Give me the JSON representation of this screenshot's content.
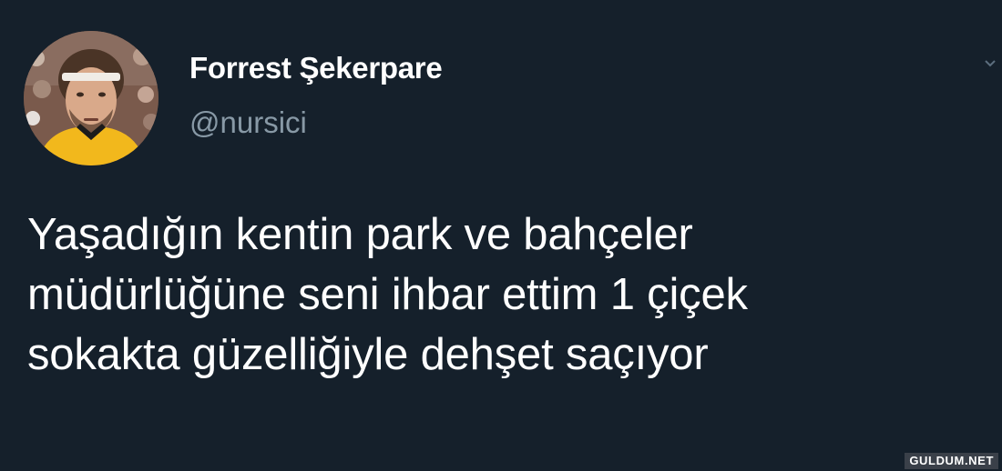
{
  "tweet": {
    "display_name": "Forrest Şekerpare",
    "handle": "@nursici",
    "text_lines": [
      "Yaşadığın kentin park ve bahçeler",
      "müdürlüğüne seni ihbar ettim 1 çiçek",
      "sokakta güzelliğiyle dehşet saçıyor"
    ],
    "avatar_icon": "profile-photo",
    "menu_icon": "chevron-down-icon"
  },
  "watermark": {
    "text": "GULDUM.NET"
  },
  "colors": {
    "background": "#15202b",
    "text": "#ffffff",
    "secondary_text": "#8899a6"
  }
}
